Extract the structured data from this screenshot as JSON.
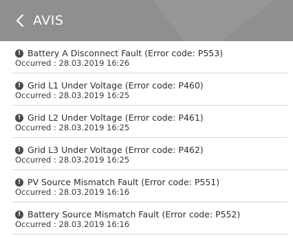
{
  "header": {
    "title": "AVIS",
    "back_icon": "chevron-left-icon"
  },
  "colors": {
    "header_bg": "#8f8f8f",
    "text": "#2e2e2e",
    "divider": "#d4d4d4",
    "alert_icon": "#4a4a4a"
  },
  "alerts": [
    {
      "message": "Battery A Disconnect Fault (Error code: P553)",
      "occurred": "Occurred : 28.03.2019 16:26"
    },
    {
      "message": "Grid L1 Under Voltage (Error code: P460)",
      "occurred": "Occurred : 28.03.2019 16:25"
    },
    {
      "message": "Grid L2 Under Voltage (Error code: P461)",
      "occurred": "Occurred : 28.03.2019 16:25"
    },
    {
      "message": "Grid L3 Under Voltage (Error code: P462)",
      "occurred": "Occurred : 28.03.2019 16:25"
    },
    {
      "message": "PV Source Mismatch Fault (Error code: P551)",
      "occurred": "Occurred : 28.03.2019 16:16"
    },
    {
      "message": "Battery Source Mismatch Fault (Error code: P552)",
      "occurred": "Occurred : 28.03.2019 16:16"
    }
  ]
}
